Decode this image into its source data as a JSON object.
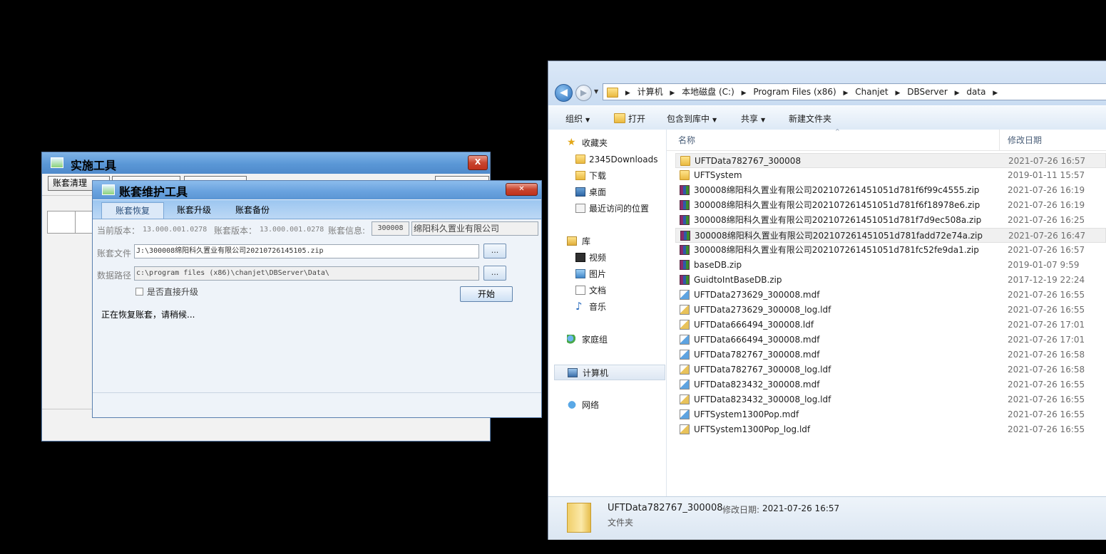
{
  "impl_window": {
    "title": "实施工具",
    "close": "X",
    "toolbar": [
      "账套清理",
      "",
      "",
      ""
    ]
  },
  "acct_window": {
    "title": "账套维护工具",
    "close": "✕",
    "tabs": [
      "账套恢复",
      "账套升级",
      "账套备份"
    ],
    "current_version_label": "当前版本：",
    "current_version": "13.000.001.0278",
    "acct_version_label": "账套版本：",
    "acct_version": "13.000.001.0278",
    "acct_info_label": "账套信息:",
    "acct_code": "300008",
    "acct_name": "绵阳科久置业有限公司",
    "file_label": "账套文件",
    "file_value": "J:\\300008绵阳科久置业有限公司20210726145105.zip",
    "browse": "...",
    "path_label": "数据路径",
    "path_value": "c:\\program files (x86)\\chanjet\\DBServer\\Data\\",
    "direct_upgrade": "是否直接升级",
    "start": "开始",
    "status": "正在恢复账套，请稍候..."
  },
  "explorer": {
    "breadcrumb": [
      "计算机",
      "本地磁盘 (C:)",
      "Program Files (x86)",
      "Chanjet",
      "DBServer",
      "data"
    ],
    "commands": {
      "organize": "组织",
      "open": "打开",
      "include": "包含到库中",
      "share": "共享",
      "new_folder": "新建文件夹"
    },
    "nav": {
      "favorites": "收藏夹",
      "downloads2345": "2345Downloads",
      "downloads": "下载",
      "desktop": "桌面",
      "recent": "最近访问的位置",
      "library": "库",
      "videos": "视频",
      "pictures": "图片",
      "documents": "文档",
      "music": "音乐",
      "homegroup": "家庭组",
      "computer": "计算机",
      "network": "网络"
    },
    "columns": {
      "name": "名称",
      "modified": "修改日期"
    },
    "files": [
      {
        "name": "UFTData782767_300008",
        "date": "2021-07-26 16:57",
        "icon": "folder"
      },
      {
        "name": "UFTSystem",
        "date": "2019-01-11 15:57",
        "icon": "folder"
      },
      {
        "name": "300008绵阳科久置业有限公司202107261451051d781f6f99c4555.zip",
        "date": "2021-07-26 16:19",
        "icon": "zip"
      },
      {
        "name": "300008绵阳科久置业有限公司202107261451051d781f6f18978e6.zip",
        "date": "2021-07-26 16:19",
        "icon": "zip"
      },
      {
        "name": "300008绵阳科久置业有限公司202107261451051d781f7d9ec508a.zip",
        "date": "2021-07-26 16:25",
        "icon": "zip"
      },
      {
        "name": "300008绵阳科久置业有限公司202107261451051d781fadd72e74a.zip",
        "date": "2021-07-26 16:47",
        "icon": "zip"
      },
      {
        "name": "300008绵阳科久置业有限公司202107261451051d781fc52fe9da1.zip",
        "date": "2021-07-26 16:57",
        "icon": "zip"
      },
      {
        "name": "baseDB.zip",
        "date": "2019-01-07 9:59",
        "icon": "zip"
      },
      {
        "name": "GuidtoIntBaseDB.zip",
        "date": "2017-12-19 22:24",
        "icon": "zip"
      },
      {
        "name": "UFTData273629_300008.mdf",
        "date": "2021-07-26 16:55",
        "icon": "mdf"
      },
      {
        "name": "UFTData273629_300008_log.ldf",
        "date": "2021-07-26 16:55",
        "icon": "ldf"
      },
      {
        "name": "UFTData666494_300008.ldf",
        "date": "2021-07-26 17:01",
        "icon": "ldf"
      },
      {
        "name": "UFTData666494_300008.mdf",
        "date": "2021-07-26 17:01",
        "icon": "mdf"
      },
      {
        "name": "UFTData782767_300008.mdf",
        "date": "2021-07-26 16:58",
        "icon": "mdf"
      },
      {
        "name": "UFTData782767_300008_log.ldf",
        "date": "2021-07-26 16:58",
        "icon": "ldf"
      },
      {
        "name": "UFTData823432_300008.mdf",
        "date": "2021-07-26 16:55",
        "icon": "mdf"
      },
      {
        "name": "UFTData823432_300008_log.ldf",
        "date": "2021-07-26 16:55",
        "icon": "ldf"
      },
      {
        "name": "UFTSystem1300Pop.mdf",
        "date": "2021-07-26 16:55",
        "icon": "mdf"
      },
      {
        "name": "UFTSystem1300Pop_log.ldf",
        "date": "2021-07-26 16:55",
        "icon": "ldf"
      }
    ],
    "details": {
      "name": "UFTData782767_300008",
      "modified_label": "修改日期:",
      "modified": "2021-07-26 16:57",
      "type": "文件夹"
    }
  }
}
